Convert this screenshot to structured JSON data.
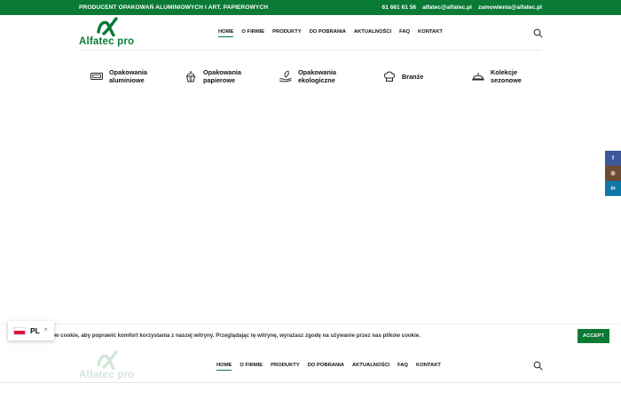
{
  "topbar": {
    "tagline": "PRODUCENT OPAKOWAŃ ALUMINIOWYCH I ART. PAPIEROWYCH",
    "phone": "61 661 61 56",
    "email1": "alfatec@alfatec.pl",
    "email2": "zamowienia@alfatec.pl",
    "bg_color": "#0a7a35"
  },
  "logo": {
    "text": "Alfatec pro",
    "icon": "alfatec-alpha-logo"
  },
  "nav": [
    {
      "label": "HOME",
      "active": true
    },
    {
      "label": "O FIRMIE"
    },
    {
      "label": "PRODUKTY"
    },
    {
      "label": "DO POBRANIA"
    },
    {
      "label": "AKTUALNOŚCI"
    },
    {
      "label": "FAQ"
    },
    {
      "label": "KONTAKT"
    }
  ],
  "search_icon": "search-icon",
  "categories": [
    {
      "label1": "Opakowania",
      "label2": "aluminiowe",
      "icon": "aluminium-tray-icon"
    },
    {
      "label1": "Opakowania",
      "label2": "papierowe",
      "icon": "cupcake-icon"
    },
    {
      "label1": "Opakowania",
      "label2": "ekologiczne",
      "icon": "eco-hand-icon"
    },
    {
      "label1": "Branże",
      "label2": "",
      "icon": "chef-hat-icon"
    },
    {
      "label1": "Kolekcje",
      "label2": "sezonowe",
      "icon": "cloche-icon"
    }
  ],
  "social": {
    "facebook": "f",
    "instagram": "◎",
    "linkedin": "in"
  },
  "cookie": {
    "text": "ów cookie, aby poprawić komfort korzystania z naszej witryny. Przeglądając tę witrynę, wyrażasz zgodę na używanie przez nas plików cookie.",
    "accept_label": "ACCEPT"
  },
  "lang": {
    "code": "PL",
    "caret": "^"
  },
  "colors": {
    "brand": "#0a7a35",
    "facebook": "#3b5998",
    "instagram": "#6f4a33",
    "linkedin": "#0e76a8"
  }
}
